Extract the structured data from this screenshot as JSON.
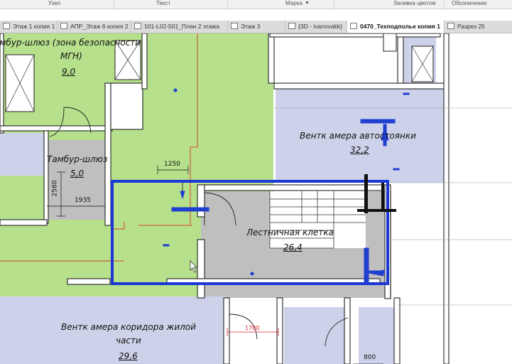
{
  "toolbar": {
    "columns": [
      "Узел",
      "Текст",
      "Марка",
      "Заливка цветом",
      "Обозначение"
    ]
  },
  "tabs": [
    {
      "label": "Этаж 1 копия 1",
      "active": false,
      "icon": "floorplan-icon"
    },
    {
      "label": "АПР_Этаж 6 копия 2",
      "active": false,
      "icon": "floorplan-icon"
    },
    {
      "label": "101-L02-501_План 2 этажа",
      "active": false,
      "icon": "floorplan-icon"
    },
    {
      "label": "Этаж 3",
      "active": false,
      "icon": "floorplan-icon"
    },
    {
      "label": "{3D - ivanovakk}",
      "active": false,
      "icon": "3d-view-icon"
    },
    {
      "label": "0470_Техподполье копия 1",
      "active": true,
      "icon": "floorplan-icon"
    },
    {
      "label": "Разрез 25",
      "active": false,
      "icon": "section-icon"
    }
  ],
  "rooms": [
    {
      "name_line1": "амбур-шлюз (зона безопасности",
      "name_line2": "МГН)",
      "area": "9,0"
    },
    {
      "name": "Тамбур-шлюз",
      "area": "5,0"
    },
    {
      "name": "Вентк амера автостоянки",
      "area": "32,2"
    },
    {
      "name": "Лестничная клетка",
      "area": "26,4"
    },
    {
      "name_line1": "Вентк амера коридора жилой",
      "name_line2": "части",
      "area": "29,6"
    }
  ],
  "dimensions": {
    "d1250": "1250",
    "d2560": "2560",
    "d1935": "1935",
    "d1700": "1700",
    "d800": "800"
  },
  "colors": {
    "green_fill": "#b6e08c",
    "lavender_fill": "#cdd2ea",
    "gray_fill": "#bfbfbf",
    "selection": "#1a37d6",
    "marker": "#1f3fd0",
    "red_line": "#d8442c",
    "dim_red": "#e0202a"
  }
}
